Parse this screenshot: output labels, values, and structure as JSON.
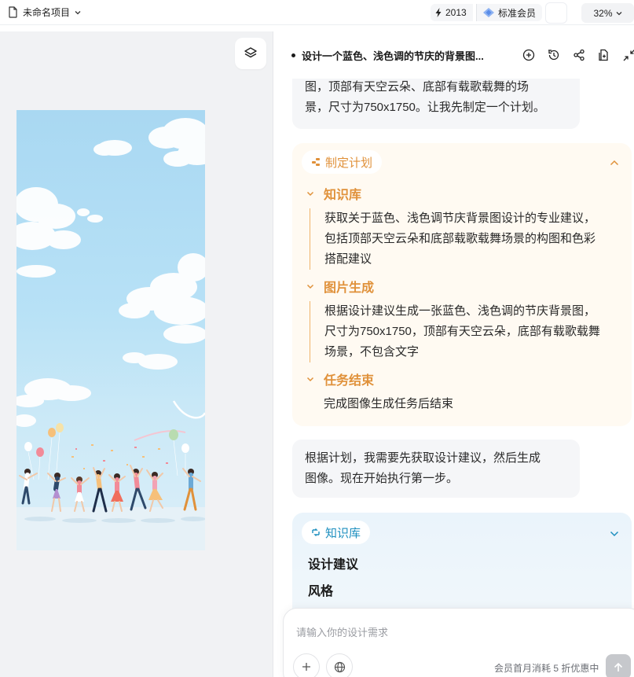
{
  "topbar": {
    "project_name": "未命名项目",
    "credits": "2013",
    "membership": "标准会员",
    "zoom": "32%"
  },
  "chat": {
    "title": "设计一个蓝色、浅色调的节庆的背景图...",
    "bubble1": {
      "line1": "图，顶部有天空云朵、底部有载歌载舞的场",
      "line2": "景，尺寸为750x1750。让我先制定一个计划。"
    },
    "plan": {
      "label": "制定计划",
      "steps": [
        {
          "title": "知识库",
          "lines": [
            "获取关于蓝色、浅色调节庆背景图设计的专业建议，",
            "包括顶部天空云朵和底部载歌载舞场景的构图和色彩",
            "搭配建议"
          ]
        },
        {
          "title": "图片生成",
          "lines": [
            "根据设计建议生成一张蓝色、浅色调的节庆背景图，",
            "尺寸为750x1750，顶部有天空云朵，底部有载歌载舞",
            "场景，不包含文字"
          ]
        },
        {
          "title": "任务结束",
          "lines": [
            "完成图像生成任务后结束"
          ]
        }
      ]
    },
    "bubble2": {
      "line1": "根据计划，我需要先获取设计建议，然后生成",
      "line2": "图像。现在开始执行第一步。"
    },
    "knowledge": {
      "label": "知识库",
      "heading1": "设计建议",
      "heading2": "风格"
    },
    "input": {
      "placeholder": "请输入你的设计需求",
      "promo": "会员首月消耗 5 折优惠中"
    }
  },
  "colors": {
    "plan_accent": "#e0913a",
    "kb_accent": "#1d8fbf"
  }
}
